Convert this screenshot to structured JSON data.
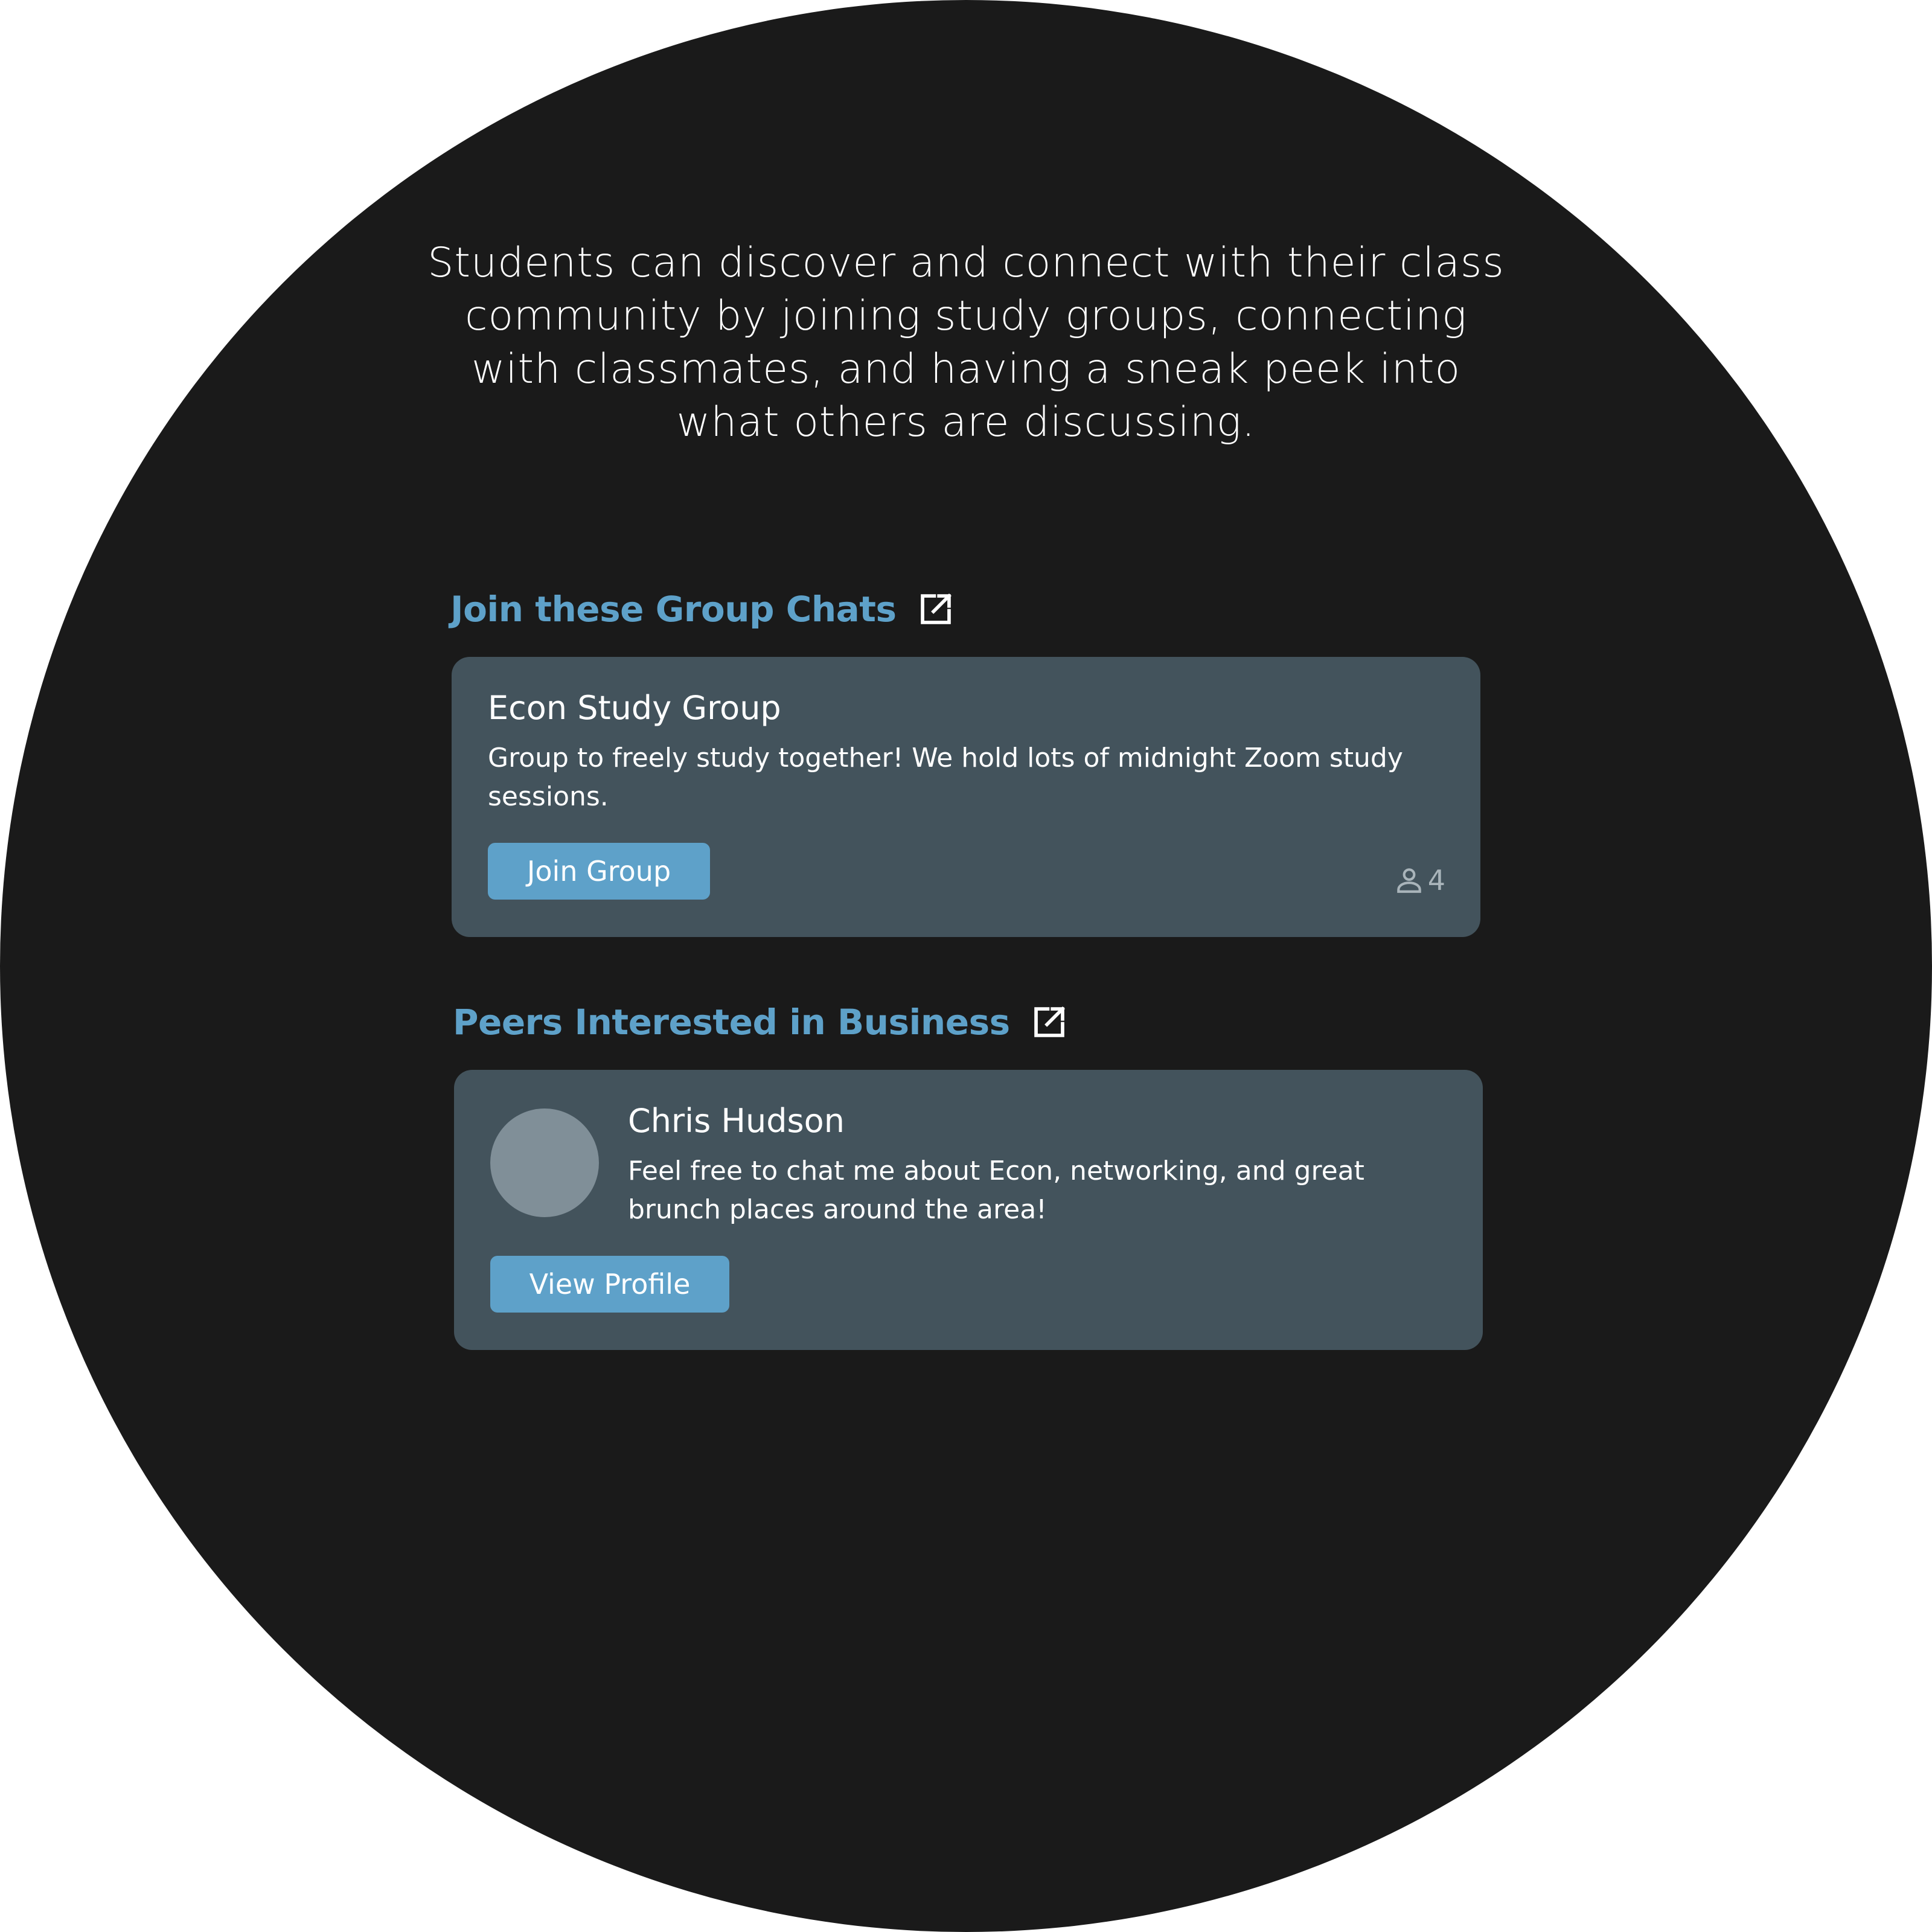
{
  "intro": {
    "text": "Students can discover and connect with their class community by joining study groups, connecting with classmates, and having a sneak peek into what others are discussing."
  },
  "group_section": {
    "heading": "Join these Group Chats",
    "icon": "external-link-icon",
    "card": {
      "title": "Econ Study Group",
      "description": "Group to freely study together! We hold lots of midnight Zoom study sessions.",
      "button_label": "Join Group",
      "member_count": "4",
      "member_icon": "person-icon"
    }
  },
  "peer_section": {
    "heading": "Peers Interested in Business",
    "icon": "external-link-icon",
    "card": {
      "name": "Chris Hudson",
      "description": "Feel free to chat me about Econ, networking, and great brunch places around the area!",
      "button_label": "View Profile"
    }
  },
  "colors": {
    "background": "#1a1a1a",
    "card": "#43535c",
    "accent": "#5ea1c9",
    "avatar_placeholder": "#808f98",
    "muted_text": "#a9b4ba"
  }
}
